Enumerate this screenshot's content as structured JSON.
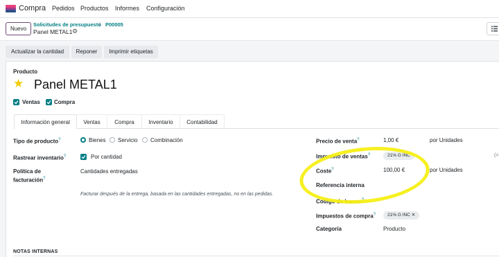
{
  "nav": {
    "app_name": "Compra",
    "menu": [
      "Pedidos",
      "Productos",
      "Informes",
      "Configuración"
    ]
  },
  "control": {
    "new_label": "Nuevo",
    "breadcrumb": [
      "Solicitudes de presupuesto",
      "P00005"
    ],
    "breadcrumb_sep": "/",
    "record_name": "Panel METAL1"
  },
  "actions": [
    "Actualizar la cantidad",
    "Reponer",
    "Imprimir etiquetas"
  ],
  "product": {
    "label": "Producto",
    "name": "Panel METAL1",
    "can_sell_label": "Ventas",
    "can_purchase_label": "Compra"
  },
  "tabs": [
    "Información general",
    "Ventas",
    "Compra",
    "Inventario",
    "Contabilidad"
  ],
  "general": {
    "type_label": "Tipo de producto",
    "type_options": [
      "Bienes",
      "Servicio",
      "Combinación"
    ],
    "track_label": "Rastrear inventario",
    "track_value": "Por cantidad",
    "invoice_label_1": "Política de",
    "invoice_label_2": "facturación",
    "invoice_value": "Cantidades entregadas",
    "invoice_hint": "Facturar después de la entrega, basada en las cantidades entregadas, no en las pedidas."
  },
  "right": {
    "sale_price_label": "Precio de venta",
    "sale_price_value": "1,00 €",
    "sale_price_unit": "por Unidades",
    "sale_tax_label": "Impuesto de ventas",
    "sale_tax_tag": "21% G INC",
    "cost_label": "Coste",
    "cost_value": "100,00 €",
    "cost_unit": "por Unidades",
    "ref_label": "Referencia interna",
    "barcode_label": "Código de barras",
    "purchase_tax_label": "Impuestos de compra",
    "purchase_tax_tag": "21% G INC",
    "category_label": "Categoría",
    "category_value": "Producto"
  },
  "notes_label": "NOTAS INTERNAS",
  "help_mark": "?",
  "edge_text": "(=",
  "colors": {
    "accent": "#017e84",
    "brand": "#714b67",
    "highlight": "#f6ef16",
    "star": "#f3cc00"
  }
}
